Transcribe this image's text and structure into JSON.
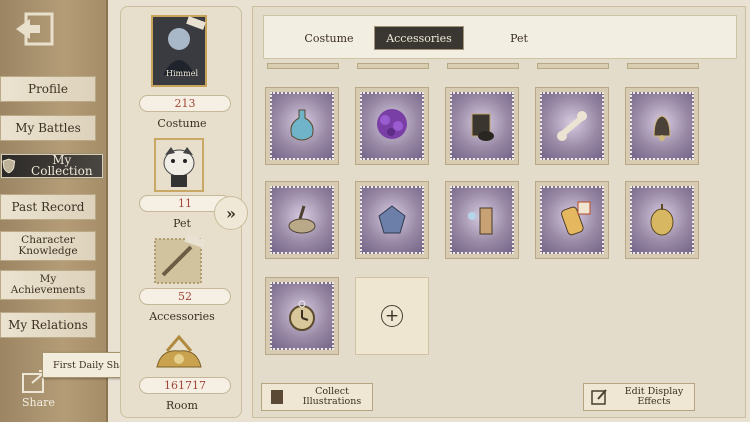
{
  "nav": {
    "items": [
      "Profile",
      "My Battles",
      "My Collection",
      "Past Record",
      "Character Knowledge",
      "My Achievements",
      "My Relations"
    ],
    "share_badge": "First Daily Share",
    "share_label": "Share"
  },
  "stats": {
    "character_name": "Himmel",
    "costume": {
      "value": "213",
      "label": "Costume"
    },
    "pet": {
      "value": "11",
      "label": "Pet"
    },
    "accessories": {
      "value": "52",
      "label": "Accessories"
    },
    "room": {
      "value": "161717",
      "label": "Room"
    }
  },
  "tabs": [
    "Costume",
    "Accessories",
    "Pet"
  ],
  "active_tab": "Accessories",
  "accessory_items": [
    "potion-bottle",
    "purple-bouquet",
    "lantern-holder",
    "bone-charm",
    "bell-charm",
    "oil-lamp",
    "crystal-stone",
    "bomb-charm",
    "potion-tube",
    "golden-bell",
    "pocket-watch"
  ],
  "buttons": {
    "collect": "Collect Illustrations",
    "edit": "Edit Display Effects"
  },
  "colors": {
    "stat_value": "#a4453b",
    "active_tab_bg": "#3a3733",
    "stamp": "#9a8aa6"
  }
}
